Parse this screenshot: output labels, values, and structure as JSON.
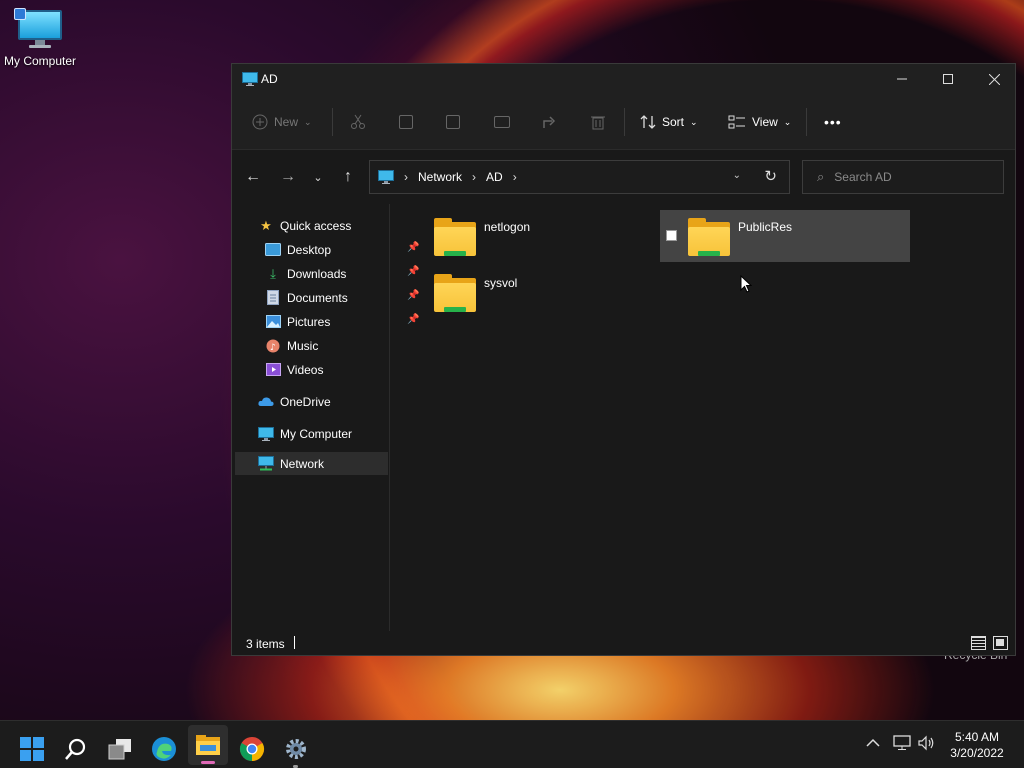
{
  "desktop": {
    "icons": [
      {
        "label": "My Computer"
      }
    ],
    "recycle_bin_label": "Recycle Bin"
  },
  "window": {
    "title": "AD",
    "toolbar": {
      "new_label": "New",
      "sort_label": "Sort",
      "view_label": "View",
      "more_label": "•••"
    },
    "address": {
      "crumbs": [
        "Network",
        "AD"
      ],
      "separator": "›"
    },
    "search": {
      "placeholder": "Search AD"
    },
    "nav": {
      "quick_access": "Quick access",
      "items": [
        {
          "label": "Desktop",
          "pinned": true
        },
        {
          "label": "Downloads",
          "pinned": true
        },
        {
          "label": "Documents",
          "pinned": true
        },
        {
          "label": "Pictures",
          "pinned": true
        },
        {
          "label": "Music",
          "pinned": false
        },
        {
          "label": "Videos",
          "pinned": false
        }
      ],
      "onedrive": "OneDrive",
      "my_computer": "My Computer",
      "network": "Network"
    },
    "folders": [
      {
        "name": "netlogon",
        "selected": false
      },
      {
        "name": "PublicRes",
        "selected": true
      },
      {
        "name": "sysvol",
        "selected": false
      }
    ],
    "status": {
      "count": "3 items"
    }
  },
  "taskbar": {
    "time": "5:40 AM",
    "date": "3/20/2022"
  },
  "colors": {
    "accent": "#2d7ad6",
    "folder_yellow": "#f7c33a",
    "network_green": "#27b24a",
    "window_bg": "#191919"
  }
}
